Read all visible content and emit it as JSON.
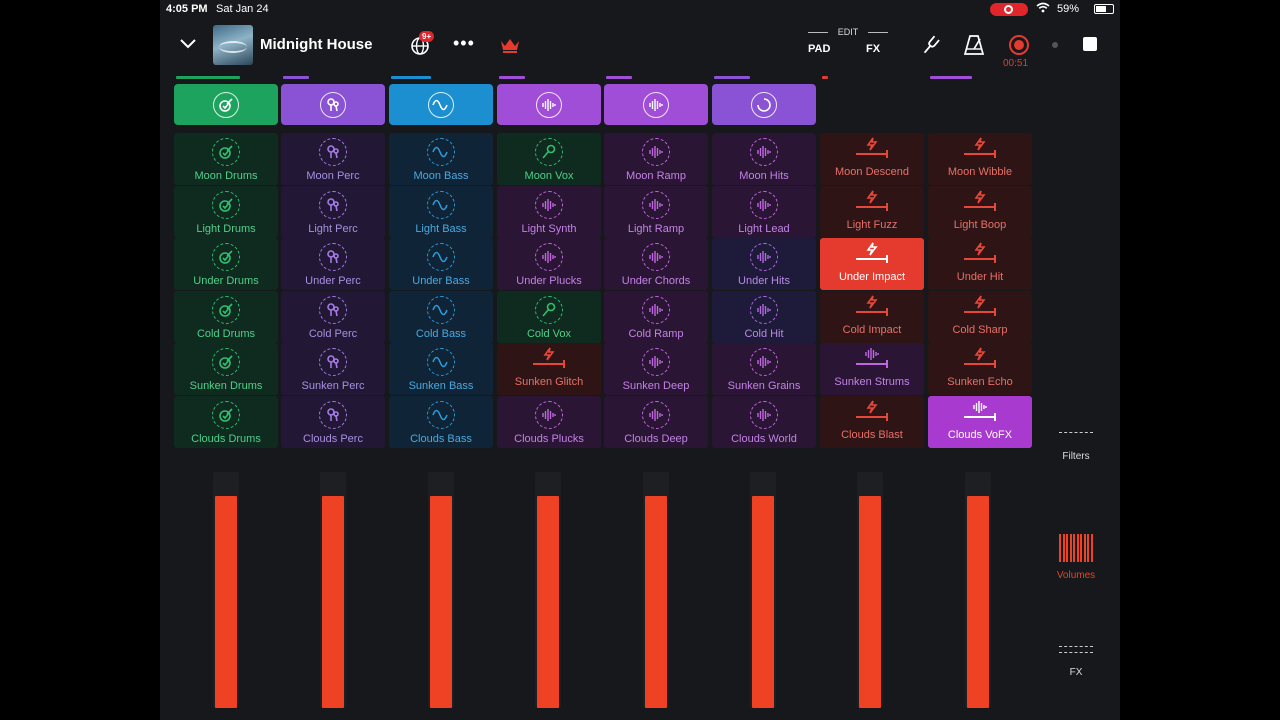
{
  "status_bar": {
    "time": "4:05 PM",
    "date": "Sat Jan 24",
    "battery": "59%"
  },
  "header": {
    "title": "Midnight House",
    "badge": "9+",
    "more": "•••",
    "edit_label": "EDIT",
    "pad_label": "PAD",
    "fx_label": "FX",
    "record_time": "00:51"
  },
  "colors": {
    "green": "#1a9a5a",
    "purple": "#8a4fd6",
    "blue": "#1e8bc6",
    "magenta": "#a64bd8",
    "red": "#e53a2e",
    "orange_volume": "#ef4123"
  },
  "column_heads": [
    {
      "color": "#1ea35f",
      "icon": "drums-icon"
    },
    {
      "color": "#8a52d4",
      "icon": "perc-icon"
    },
    {
      "color": "#1c8fd0",
      "icon": "wave-icon"
    },
    {
      "color": "#a04ed8",
      "icon": "waveform-icon"
    },
    {
      "color": "#a04ed8",
      "icon": "waveform-icon"
    },
    {
      "color": "#8a52d4",
      "icon": "spinner-icon"
    }
  ],
  "columns": [
    {
      "theme": "green",
      "cells": [
        {
          "label": "Moon Drums",
          "icon": "drums-icon"
        },
        {
          "label": "Light Drums",
          "icon": "drums-icon"
        },
        {
          "label": "Under Drums",
          "icon": "drums-icon"
        },
        {
          "label": "Cold Drums",
          "icon": "drums-icon"
        },
        {
          "label": "Sunken Drums",
          "icon": "drums-icon"
        },
        {
          "label": "Clouds Drums",
          "icon": "drums-icon"
        }
      ]
    },
    {
      "theme": "purple",
      "cells": [
        {
          "label": "Moon Perc",
          "icon": "perc-icon"
        },
        {
          "label": "Light Perc",
          "icon": "perc-icon"
        },
        {
          "label": "Under Perc",
          "icon": "perc-icon"
        },
        {
          "label": "Cold Perc",
          "icon": "perc-icon"
        },
        {
          "label": "Sunken Perc",
          "icon": "perc-icon"
        },
        {
          "label": "Clouds Perc",
          "icon": "perc-icon"
        }
      ]
    },
    {
      "theme": "blue",
      "cells": [
        {
          "label": "Moon Bass",
          "icon": "wave-icon"
        },
        {
          "label": "Light Bass",
          "icon": "wave-icon"
        },
        {
          "label": "Under Bass",
          "icon": "wave-icon"
        },
        {
          "label": "Cold Bass",
          "icon": "wave-icon"
        },
        {
          "label": "Sunken Bass",
          "icon": "wave-icon"
        },
        {
          "label": "Clouds Bass",
          "icon": "wave-icon"
        }
      ]
    },
    {
      "theme": "mixed",
      "cells": [
        {
          "label": "Moon Vox",
          "icon": "mic-icon",
          "theme": "green"
        },
        {
          "label": "Light Synth",
          "icon": "waveform-icon",
          "theme": "magenta"
        },
        {
          "label": "Under Plucks",
          "icon": "waveform-icon",
          "theme": "magenta"
        },
        {
          "label": "Cold Vox",
          "icon": "mic-icon",
          "theme": "green"
        },
        {
          "label": "Sunken Glitch",
          "icon": "bolt-icon",
          "theme": "red"
        },
        {
          "label": "Clouds Plucks",
          "icon": "waveform-icon",
          "theme": "magenta"
        }
      ]
    },
    {
      "theme": "magenta",
      "cells": [
        {
          "label": "Moon Ramp",
          "icon": "waveform-icon"
        },
        {
          "label": "Light Ramp",
          "icon": "waveform-icon"
        },
        {
          "label": "Under Chords",
          "icon": "waveform-icon"
        },
        {
          "label": "Cold Ramp",
          "icon": "waveform-icon"
        },
        {
          "label": "Sunken Deep",
          "icon": "waveform-icon"
        },
        {
          "label": "Clouds Deep",
          "icon": "waveform-icon"
        }
      ]
    },
    {
      "theme": "magenta",
      "cells": [
        {
          "label": "Moon Hits",
          "icon": "waveform-icon"
        },
        {
          "label": "Light Lead",
          "icon": "waveform-icon"
        },
        {
          "label": "Under Hits",
          "icon": "waveform-icon",
          "theme": "indigo"
        },
        {
          "label": "Cold Hit",
          "icon": "waveform-icon",
          "theme": "indigo"
        },
        {
          "label": "Sunken Grains",
          "icon": "waveform-icon"
        },
        {
          "label": "Clouds World",
          "icon": "waveform-icon"
        }
      ]
    },
    {
      "theme": "red",
      "cells": [
        {
          "label": "Moon Descend",
          "icon": "bolt-icon"
        },
        {
          "label": "Light Fuzz",
          "icon": "bolt-icon"
        },
        {
          "label": "Under Impact",
          "icon": "bolt-icon",
          "active": true
        },
        {
          "label": "Cold Impact",
          "icon": "bolt-icon"
        },
        {
          "label": "Sunken Strums",
          "icon": "waveform-icon",
          "theme": "magenta-fx"
        },
        {
          "label": "Clouds Blast",
          "icon": "bolt-icon"
        }
      ]
    },
    {
      "theme": "red",
      "cells": [
        {
          "label": "Moon Wibble",
          "icon": "bolt-icon"
        },
        {
          "label": "Light Boop",
          "icon": "bolt-icon"
        },
        {
          "label": "Under Hit",
          "icon": "bolt-icon"
        },
        {
          "label": "Cold Sharp",
          "icon": "bolt-icon"
        },
        {
          "label": "Sunken Echo",
          "icon": "bolt-icon"
        },
        {
          "label": "Clouds VoFX",
          "icon": "waveform-icon",
          "theme": "magenta-fx",
          "active": true
        }
      ]
    }
  ],
  "volumes": [
    0.9,
    0.9,
    0.9,
    0.9,
    0.9,
    0.9,
    0.9,
    0.9
  ],
  "side_nav": {
    "filters": "Filters",
    "volumes": "Volumes",
    "fx": "FX"
  }
}
